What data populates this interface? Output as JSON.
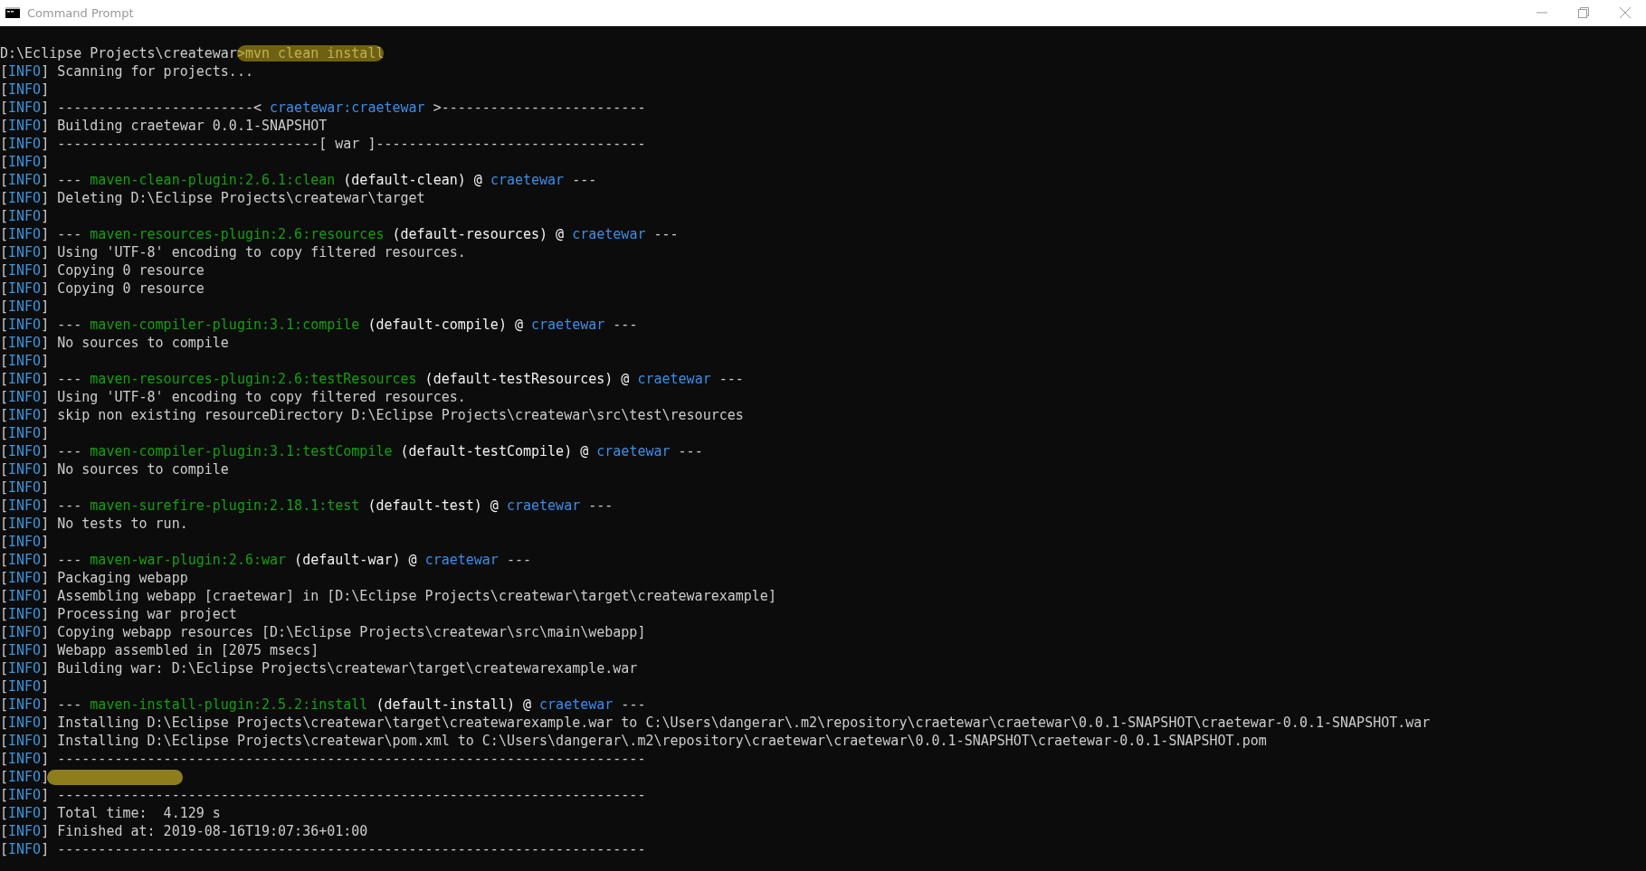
{
  "window": {
    "title": "Command Prompt"
  },
  "prompt": {
    "segments": [
      {
        "kind": "plain",
        "text": "D:\\Eclipse Projects\\createwar"
      },
      {
        "kind": "highlighted",
        "text": ">mvn clean install"
      }
    ]
  },
  "lines": [
    {
      "segments": [
        {
          "kind": "plain",
          "text": "["
        },
        {
          "kind": "tag",
          "text": "INFO"
        },
        {
          "kind": "plain",
          "text": "] Scanning for projects..."
        }
      ]
    },
    {
      "segments": [
        {
          "kind": "plain",
          "text": "["
        },
        {
          "kind": "tag",
          "text": "INFO"
        },
        {
          "kind": "plain",
          "text": "]"
        }
      ]
    },
    {
      "segments": [
        {
          "kind": "plain",
          "text": "["
        },
        {
          "kind": "tag",
          "text": "INFO"
        },
        {
          "kind": "plain",
          "text": "] ------------------------< "
        },
        {
          "kind": "project",
          "text": "craetewar:craetewar"
        },
        {
          "kind": "plain",
          "text": " >-------------------------"
        }
      ]
    },
    {
      "segments": [
        {
          "kind": "plain",
          "text": "["
        },
        {
          "kind": "tag",
          "text": "INFO"
        },
        {
          "kind": "plain",
          "text": "] Building craetewar 0.0.1-SNAPSHOT"
        }
      ]
    },
    {
      "segments": [
        {
          "kind": "plain",
          "text": "["
        },
        {
          "kind": "tag",
          "text": "INFO"
        },
        {
          "kind": "plain",
          "text": "] --------------------------------[ war ]---------------------------------"
        }
      ]
    },
    {
      "segments": [
        {
          "kind": "plain",
          "text": "["
        },
        {
          "kind": "tag",
          "text": "INFO"
        },
        {
          "kind": "plain",
          "text": "]"
        }
      ]
    },
    {
      "segments": [
        {
          "kind": "plain",
          "text": "["
        },
        {
          "kind": "tag",
          "text": "INFO"
        },
        {
          "kind": "plain",
          "text": "] --- "
        },
        {
          "kind": "plugin",
          "text": "maven-clean-plugin:2.6.1:clean"
        },
        {
          "kind": "bright",
          "text": " (default-clean) @ "
        },
        {
          "kind": "project",
          "text": "craetewar"
        },
        {
          "kind": "plain",
          "text": " ---"
        }
      ]
    },
    {
      "segments": [
        {
          "kind": "plain",
          "text": "["
        },
        {
          "kind": "tag",
          "text": "INFO"
        },
        {
          "kind": "plain",
          "text": "] Deleting D:\\Eclipse Projects\\createwar\\target"
        }
      ]
    },
    {
      "segments": [
        {
          "kind": "plain",
          "text": "["
        },
        {
          "kind": "tag",
          "text": "INFO"
        },
        {
          "kind": "plain",
          "text": "]"
        }
      ]
    },
    {
      "segments": [
        {
          "kind": "plain",
          "text": "["
        },
        {
          "kind": "tag",
          "text": "INFO"
        },
        {
          "kind": "plain",
          "text": "] --- "
        },
        {
          "kind": "plugin",
          "text": "maven-resources-plugin:2.6:resources"
        },
        {
          "kind": "bright",
          "text": " (default-resources) @ "
        },
        {
          "kind": "project",
          "text": "craetewar"
        },
        {
          "kind": "plain",
          "text": " ---"
        }
      ]
    },
    {
      "segments": [
        {
          "kind": "plain",
          "text": "["
        },
        {
          "kind": "tag",
          "text": "INFO"
        },
        {
          "kind": "plain",
          "text": "] Using 'UTF-8' encoding to copy filtered resources."
        }
      ]
    },
    {
      "segments": [
        {
          "kind": "plain",
          "text": "["
        },
        {
          "kind": "tag",
          "text": "INFO"
        },
        {
          "kind": "plain",
          "text": "] Copying 0 resource"
        }
      ]
    },
    {
      "segments": [
        {
          "kind": "plain",
          "text": "["
        },
        {
          "kind": "tag",
          "text": "INFO"
        },
        {
          "kind": "plain",
          "text": "] Copying 0 resource"
        }
      ]
    },
    {
      "segments": [
        {
          "kind": "plain",
          "text": "["
        },
        {
          "kind": "tag",
          "text": "INFO"
        },
        {
          "kind": "plain",
          "text": "]"
        }
      ]
    },
    {
      "segments": [
        {
          "kind": "plain",
          "text": "["
        },
        {
          "kind": "tag",
          "text": "INFO"
        },
        {
          "kind": "plain",
          "text": "] --- "
        },
        {
          "kind": "plugin",
          "text": "maven-compiler-plugin:3.1:compile"
        },
        {
          "kind": "bright",
          "text": " (default-compile) @ "
        },
        {
          "kind": "project",
          "text": "craetewar"
        },
        {
          "kind": "plain",
          "text": " ---"
        }
      ]
    },
    {
      "segments": [
        {
          "kind": "plain",
          "text": "["
        },
        {
          "kind": "tag",
          "text": "INFO"
        },
        {
          "kind": "plain",
          "text": "] No sources to compile"
        }
      ]
    },
    {
      "segments": [
        {
          "kind": "plain",
          "text": "["
        },
        {
          "kind": "tag",
          "text": "INFO"
        },
        {
          "kind": "plain",
          "text": "]"
        }
      ]
    },
    {
      "segments": [
        {
          "kind": "plain",
          "text": "["
        },
        {
          "kind": "tag",
          "text": "INFO"
        },
        {
          "kind": "plain",
          "text": "] --- "
        },
        {
          "kind": "plugin",
          "text": "maven-resources-plugin:2.6:testResources"
        },
        {
          "kind": "bright",
          "text": " (default-testResources) @ "
        },
        {
          "kind": "project",
          "text": "craetewar"
        },
        {
          "kind": "plain",
          "text": " ---"
        }
      ]
    },
    {
      "segments": [
        {
          "kind": "plain",
          "text": "["
        },
        {
          "kind": "tag",
          "text": "INFO"
        },
        {
          "kind": "plain",
          "text": "] Using 'UTF-8' encoding to copy filtered resources."
        }
      ]
    },
    {
      "segments": [
        {
          "kind": "plain",
          "text": "["
        },
        {
          "kind": "tag",
          "text": "INFO"
        },
        {
          "kind": "plain",
          "text": "] skip non existing resourceDirectory D:\\Eclipse Projects\\createwar\\src\\test\\resources"
        }
      ]
    },
    {
      "segments": [
        {
          "kind": "plain",
          "text": "["
        },
        {
          "kind": "tag",
          "text": "INFO"
        },
        {
          "kind": "plain",
          "text": "]"
        }
      ]
    },
    {
      "segments": [
        {
          "kind": "plain",
          "text": "["
        },
        {
          "kind": "tag",
          "text": "INFO"
        },
        {
          "kind": "plain",
          "text": "] --- "
        },
        {
          "kind": "plugin",
          "text": "maven-compiler-plugin:3.1:testCompile"
        },
        {
          "kind": "bright",
          "text": " (default-testCompile) @ "
        },
        {
          "kind": "project",
          "text": "craetewar"
        },
        {
          "kind": "plain",
          "text": " ---"
        }
      ]
    },
    {
      "segments": [
        {
          "kind": "plain",
          "text": "["
        },
        {
          "kind": "tag",
          "text": "INFO"
        },
        {
          "kind": "plain",
          "text": "] No sources to compile"
        }
      ]
    },
    {
      "segments": [
        {
          "kind": "plain",
          "text": "["
        },
        {
          "kind": "tag",
          "text": "INFO"
        },
        {
          "kind": "plain",
          "text": "]"
        }
      ]
    },
    {
      "segments": [
        {
          "kind": "plain",
          "text": "["
        },
        {
          "kind": "tag",
          "text": "INFO"
        },
        {
          "kind": "plain",
          "text": "] --- "
        },
        {
          "kind": "plugin",
          "text": "maven-surefire-plugin:2.18.1:test"
        },
        {
          "kind": "bright",
          "text": " (default-test) @ "
        },
        {
          "kind": "project",
          "text": "craetewar"
        },
        {
          "kind": "plain",
          "text": " ---"
        }
      ]
    },
    {
      "segments": [
        {
          "kind": "plain",
          "text": "["
        },
        {
          "kind": "tag",
          "text": "INFO"
        },
        {
          "kind": "plain",
          "text": "] No tests to run."
        }
      ]
    },
    {
      "segments": [
        {
          "kind": "plain",
          "text": "["
        },
        {
          "kind": "tag",
          "text": "INFO"
        },
        {
          "kind": "plain",
          "text": "]"
        }
      ]
    },
    {
      "segments": [
        {
          "kind": "plain",
          "text": "["
        },
        {
          "kind": "tag",
          "text": "INFO"
        },
        {
          "kind": "plain",
          "text": "] --- "
        },
        {
          "kind": "plugin",
          "text": "maven-war-plugin:2.6:war"
        },
        {
          "kind": "bright",
          "text": " (default-war) @ "
        },
        {
          "kind": "project",
          "text": "craetewar"
        },
        {
          "kind": "plain",
          "text": " ---"
        }
      ]
    },
    {
      "segments": [
        {
          "kind": "plain",
          "text": "["
        },
        {
          "kind": "tag",
          "text": "INFO"
        },
        {
          "kind": "plain",
          "text": "] Packaging webapp"
        }
      ]
    },
    {
      "segments": [
        {
          "kind": "plain",
          "text": "["
        },
        {
          "kind": "tag",
          "text": "INFO"
        },
        {
          "kind": "plain",
          "text": "] Assembling webapp [craetewar] in [D:\\Eclipse Projects\\createwar\\target\\createwarexample]"
        }
      ]
    },
    {
      "segments": [
        {
          "kind": "plain",
          "text": "["
        },
        {
          "kind": "tag",
          "text": "INFO"
        },
        {
          "kind": "plain",
          "text": "] Processing war project"
        }
      ]
    },
    {
      "segments": [
        {
          "kind": "plain",
          "text": "["
        },
        {
          "kind": "tag",
          "text": "INFO"
        },
        {
          "kind": "plain",
          "text": "] Copying webapp resources [D:\\Eclipse Projects\\createwar\\src\\main\\webapp]"
        }
      ]
    },
    {
      "segments": [
        {
          "kind": "plain",
          "text": "["
        },
        {
          "kind": "tag",
          "text": "INFO"
        },
        {
          "kind": "plain",
          "text": "] Webapp assembled in [2075 msecs]"
        }
      ]
    },
    {
      "segments": [
        {
          "kind": "plain",
          "text": "["
        },
        {
          "kind": "tag",
          "text": "INFO"
        },
        {
          "kind": "plain",
          "text": "] Building war: D:\\Eclipse Projects\\createwar\\target\\createwarexample.war"
        }
      ]
    },
    {
      "segments": [
        {
          "kind": "plain",
          "text": "["
        },
        {
          "kind": "tag",
          "text": "INFO"
        },
        {
          "kind": "plain",
          "text": "]"
        }
      ]
    },
    {
      "segments": [
        {
          "kind": "plain",
          "text": "["
        },
        {
          "kind": "tag",
          "text": "INFO"
        },
        {
          "kind": "plain",
          "text": "] --- "
        },
        {
          "kind": "plugin",
          "text": "maven-install-plugin:2.5.2:install"
        },
        {
          "kind": "bright",
          "text": " (default-install) @ "
        },
        {
          "kind": "project",
          "text": "craetewar"
        },
        {
          "kind": "plain",
          "text": " ---"
        }
      ]
    },
    {
      "segments": [
        {
          "kind": "plain",
          "text": "["
        },
        {
          "kind": "tag",
          "text": "INFO"
        },
        {
          "kind": "plain",
          "text": "] Installing D:\\Eclipse Projects\\createwar\\target\\createwarexample.war to C:\\Users\\dangerar\\.m2\\repository\\craetewar\\craetewar\\0.0.1-SNAPSHOT\\craetewar-0.0.1-SNAPSHOT.war"
        }
      ]
    },
    {
      "segments": [
        {
          "kind": "plain",
          "text": "["
        },
        {
          "kind": "tag",
          "text": "INFO"
        },
        {
          "kind": "plain",
          "text": "] Installing D:\\Eclipse Projects\\createwar\\pom.xml to C:\\Users\\dangerar\\.m2\\repository\\craetewar\\craetewar\\0.0.1-SNAPSHOT\\craetewar-0.0.1-SNAPSHOT.pom"
        }
      ]
    },
    {
      "segments": [
        {
          "kind": "plain",
          "text": "["
        },
        {
          "kind": "tag",
          "text": "INFO"
        },
        {
          "kind": "plain",
          "text": "] ------------------------------------------------------------------------"
        }
      ]
    },
    {
      "marked": true,
      "segments": [
        {
          "kind": "plain",
          "text": "["
        },
        {
          "kind": "tag",
          "text": "INFO"
        },
        {
          "kind": "plain",
          "text": "]"
        }
      ]
    },
    {
      "segments": [
        {
          "kind": "plain",
          "text": "["
        },
        {
          "kind": "tag",
          "text": "INFO"
        },
        {
          "kind": "plain",
          "text": "] ------------------------------------------------------------------------"
        }
      ]
    },
    {
      "segments": [
        {
          "kind": "plain",
          "text": "["
        },
        {
          "kind": "tag",
          "text": "INFO"
        },
        {
          "kind": "plain",
          "text": "] Total time:  4.129 s"
        }
      ]
    },
    {
      "segments": [
        {
          "kind": "plain",
          "text": "["
        },
        {
          "kind": "tag",
          "text": "INFO"
        },
        {
          "kind": "plain",
          "text": "] Finished at: 2019-08-16T19:07:36+01:00"
        }
      ]
    },
    {
      "segments": [
        {
          "kind": "plain",
          "text": "["
        },
        {
          "kind": "tag",
          "text": "INFO"
        },
        {
          "kind": "plain",
          "text": "] ------------------------------------------------------------------------"
        }
      ]
    }
  ]
}
